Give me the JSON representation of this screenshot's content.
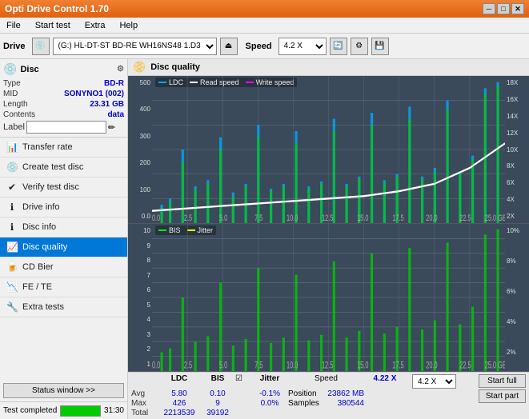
{
  "titleBar": {
    "title": "Opti Drive Control 1.70",
    "minimize": "─",
    "maximize": "□",
    "close": "✕"
  },
  "menuBar": {
    "items": [
      "File",
      "Start test",
      "Extra",
      "Help"
    ]
  },
  "toolbar": {
    "driveLabel": "Drive",
    "driveValue": "(G:)  HL-DT-ST BD-RE  WH16NS48 1.D3",
    "speedLabel": "Speed",
    "speedValue": "4.2 X"
  },
  "discSection": {
    "title": "Disc",
    "type": {
      "label": "Type",
      "value": "BD-R"
    },
    "mid": {
      "label": "MID",
      "value": "SONYNO1 (002)"
    },
    "length": {
      "label": "Length",
      "value": "23.31 GB"
    },
    "contents": {
      "label": "Contents",
      "value": "data"
    },
    "labelField": {
      "label": "Label",
      "placeholder": ""
    }
  },
  "navItems": [
    {
      "id": "transfer-rate",
      "label": "Transfer rate",
      "icon": "📊"
    },
    {
      "id": "create-test-disc",
      "label": "Create test disc",
      "icon": "💿"
    },
    {
      "id": "verify-test-disc",
      "label": "Verify test disc",
      "icon": "✔"
    },
    {
      "id": "drive-info",
      "label": "Drive info",
      "icon": "ℹ"
    },
    {
      "id": "disc-info",
      "label": "Disc info",
      "icon": "ℹ"
    },
    {
      "id": "disc-quality",
      "label": "Disc quality",
      "icon": "📈",
      "active": true
    },
    {
      "id": "cd-bier",
      "label": "CD Bier",
      "icon": "🍺"
    },
    {
      "id": "fe-te",
      "label": "FE / TE",
      "icon": "📉"
    },
    {
      "id": "extra-tests",
      "label": "Extra tests",
      "icon": "🔧"
    }
  ],
  "statusBtn": "Status window >>",
  "progressBar": {
    "percent": 100,
    "label": "Test completed",
    "time": "31:30"
  },
  "chartHeader": {
    "icon": "📀",
    "title": "Disc quality"
  },
  "chart1": {
    "title": "LDC chart",
    "legend": [
      {
        "label": "LDC",
        "color": "#00aaff"
      },
      {
        "label": "Read speed",
        "color": "#ffffff"
      },
      {
        "label": "Write speed",
        "color": "#ff00ff"
      }
    ],
    "yAxisLeft": [
      "500",
      "400",
      "300",
      "200",
      "100",
      "0.0"
    ],
    "yAxisRight": [
      "18X",
      "16X",
      "14X",
      "12X",
      "10X",
      "8X",
      "6X",
      "4X",
      "2X"
    ],
    "xAxis": [
      "0.0",
      "2.5",
      "5.0",
      "7.5",
      "10.0",
      "12.5",
      "15.0",
      "17.5",
      "20.0",
      "22.5",
      "25.0 GB"
    ]
  },
  "chart2": {
    "title": "BIS chart",
    "legend": [
      {
        "label": "BIS",
        "color": "#00ff00"
      },
      {
        "label": "Jitter",
        "color": "#ffff00"
      }
    ],
    "yAxisLeft": [
      "10",
      "9",
      "8",
      "7",
      "6",
      "5",
      "4",
      "3",
      "2",
      "1"
    ],
    "yAxisRight": [
      "10%",
      "8%",
      "6%",
      "4%",
      "2%"
    ],
    "xAxis": [
      "0.0",
      "2.5",
      "5.0",
      "7.5",
      "10.0",
      "12.5",
      "15.0",
      "17.5",
      "20.0",
      "22.5",
      "25.0 GB"
    ]
  },
  "statsBar": {
    "columns": [
      {
        "header": "",
        "rows": [
          "Avg",
          "Max",
          "Total"
        ]
      },
      {
        "header": "LDC",
        "rows": [
          "5.80",
          "426",
          "2213539"
        ]
      },
      {
        "header": "BIS",
        "rows": [
          "0.10",
          "9",
          "39192"
        ]
      }
    ],
    "jitter": {
      "label": "Jitter",
      "checked": true,
      "rows": [
        "-0.1%",
        "0.0%",
        ""
      ]
    },
    "speed": {
      "label": "Speed",
      "value": "4.22 X",
      "dropdownValue": "4.2 X",
      "rows": [
        "Position",
        "Samples"
      ],
      "values": [
        "23862 MB",
        "380544"
      ]
    },
    "buttons": [
      "Start full",
      "Start part"
    ]
  }
}
